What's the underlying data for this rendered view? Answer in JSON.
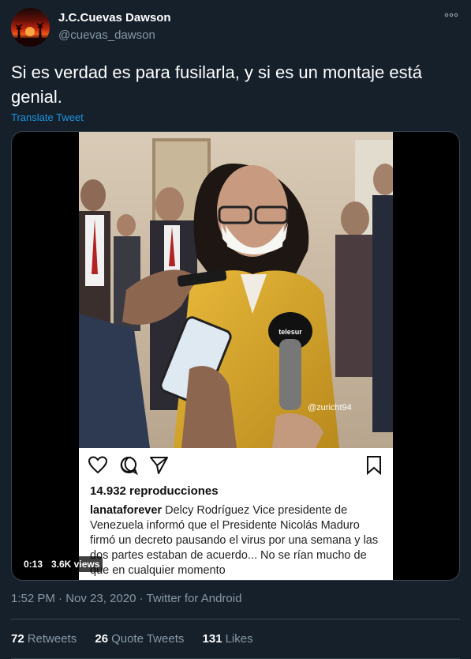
{
  "author": {
    "display_name": "J.C.Cuevas Dawson",
    "handle": "@cuevas_dawson",
    "avatar": "sunset-silhouette-avatar"
  },
  "more_icon": "more-dots-icon",
  "tweet": {
    "text": "Si es verdad es para fusilarla, y si es un montaje está genial.",
    "translate_label": "Translate Tweet"
  },
  "video": {
    "watermark": "@zuricht94",
    "mic_label": "telesur",
    "timestamp": "0:13",
    "views": "3.6K views",
    "instagram": {
      "icons": [
        "heart-icon",
        "comment-icon",
        "share-icon",
        "bookmark-icon"
      ],
      "reproducciones": "14.932 reproducciones",
      "username": "lanataforever",
      "caption": "Delcy Rodríguez Vice presidente de Venezuela informó que el Presidente Nicolás Maduro firmó un decreto pausando el virus por una semana y las dos partes estaban de acuerdo... No se rían mucho de que en cualquier momento"
    }
  },
  "meta": {
    "time": "1:52 PM",
    "separator1": "·",
    "date": "Nov 23, 2020",
    "separator2": "·",
    "source": "Twitter for Android"
  },
  "stats": {
    "retweets_count": "72",
    "retweets_label": "Retweets",
    "quote_count": "26",
    "quote_label": "Quote Tweets",
    "likes_count": "131",
    "likes_label": "Likes"
  },
  "colors": {
    "background": "#15202b",
    "link": "#1b95e0",
    "secondary_text": "#8899a6",
    "border": "#38444d"
  }
}
